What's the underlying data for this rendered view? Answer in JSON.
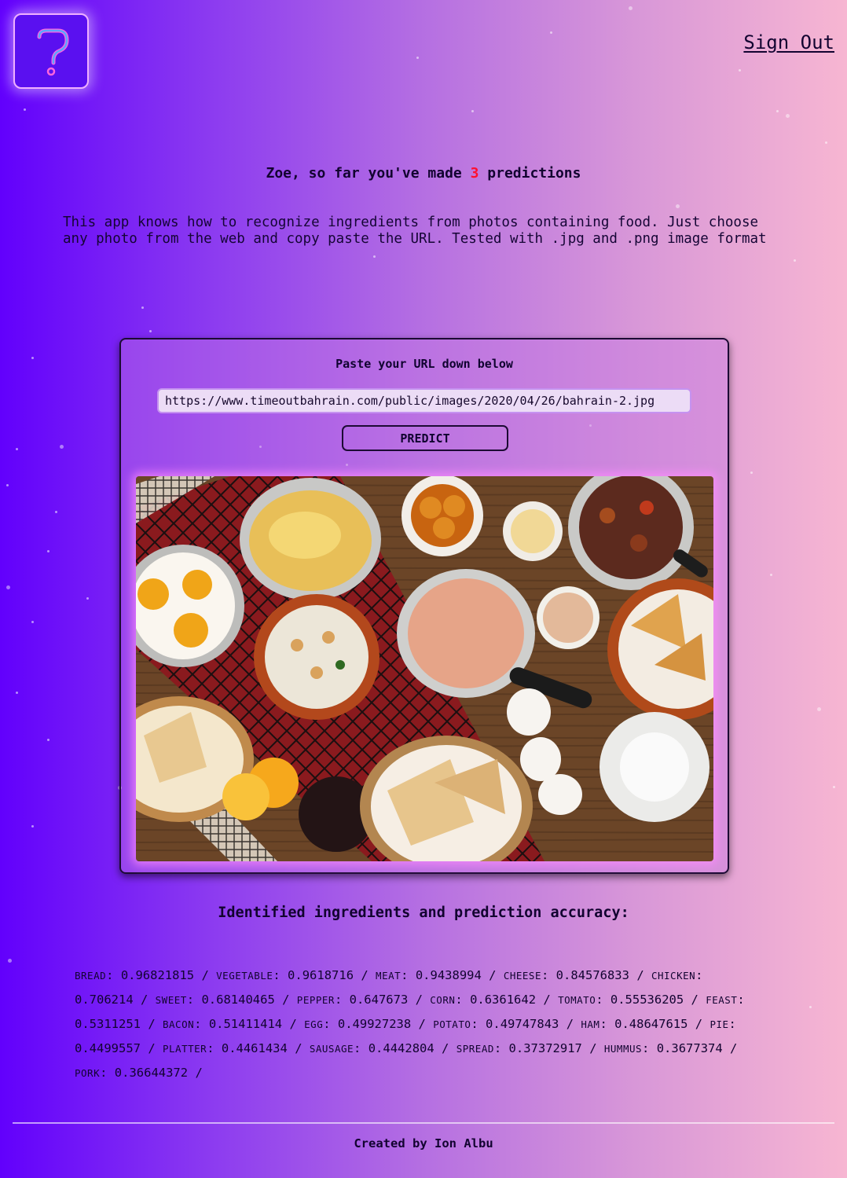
{
  "header": {
    "logo_icon": "question-mark-icon",
    "sign_out_label": "Sign Out"
  },
  "greeting": {
    "prefix": "Zoe, so far you've made ",
    "count": "3",
    "suffix": " predictions"
  },
  "intro": {
    "line1": "This app knows how to recognize ingredients from photos containing food. Just choose",
    "line2": "any photo from the web and copy paste the URL. Tested with .jpg and .png image format"
  },
  "form": {
    "title": "Paste your URL down below",
    "url_value": "https://www.timeoutbahrain.com/public/images/2020/04/26/bahrain-2.jpg",
    "predict_label": "PREDICT"
  },
  "results": {
    "heading": "Identified ingredients and prediction accuracy:",
    "rows": [
      [
        {
          "name": "bread",
          "value": "0.96821815"
        },
        {
          "name": "vegetable",
          "value": "0.9618716"
        },
        {
          "name": "meat",
          "value": "0.9438994"
        },
        {
          "name": "cheese",
          "value": "0.84576833"
        },
        {
          "name": "chicken",
          "value": ""
        }
      ],
      [
        {
          "name": "",
          "value": "0.706214"
        },
        {
          "name": "sweet",
          "value": "0.68140465"
        },
        {
          "name": "pepper",
          "value": "0.647673"
        },
        {
          "name": "corn",
          "value": "0.6361642"
        },
        {
          "name": "tomato",
          "value": "0.55536205"
        },
        {
          "name": "feast",
          "value": ""
        }
      ],
      [
        {
          "name": "",
          "value": "0.5311251"
        },
        {
          "name": "bacon",
          "value": "0.51411414"
        },
        {
          "name": "egg",
          "value": "0.49927238"
        },
        {
          "name": "potato",
          "value": "0.49747843"
        },
        {
          "name": "ham",
          "value": "0.48647615"
        },
        {
          "name": "pie",
          "value": ""
        }
      ],
      [
        {
          "name": "",
          "value": "0.4499557"
        },
        {
          "name": "platter",
          "value": "0.4461434"
        },
        {
          "name": "sausage",
          "value": "0.4442804"
        },
        {
          "name": "spread",
          "value": "0.37372917"
        },
        {
          "name": "hummus",
          "value": "0.3677374"
        }
      ],
      [
        {
          "name": "pork",
          "value": "0.36644372"
        }
      ]
    ]
  },
  "footer": {
    "credit": "Created by Ion Albu"
  }
}
